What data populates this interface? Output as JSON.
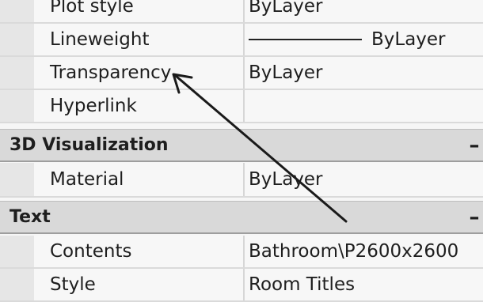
{
  "properties_top": [
    {
      "name": "Plot style",
      "value": "ByLayer"
    },
    {
      "name": "Lineweight",
      "value": "ByLayer"
    },
    {
      "name": "Transparency",
      "value": "ByLayer"
    },
    {
      "name": "Hyperlink",
      "value": ""
    }
  ],
  "sections": [
    {
      "title": "3D Visualization",
      "toggle": "–",
      "properties": [
        {
          "name": "Material",
          "value": "ByLayer"
        }
      ]
    },
    {
      "title": "Text",
      "toggle": "–",
      "properties": [
        {
          "name": "Contents",
          "value": "Bathroom\\P2600x2600"
        },
        {
          "name": "Style",
          "value": "Room Titles"
        }
      ]
    }
  ],
  "annotation": {
    "color": "#1a1a1a",
    "icon": "arrow-pointer-icon"
  }
}
